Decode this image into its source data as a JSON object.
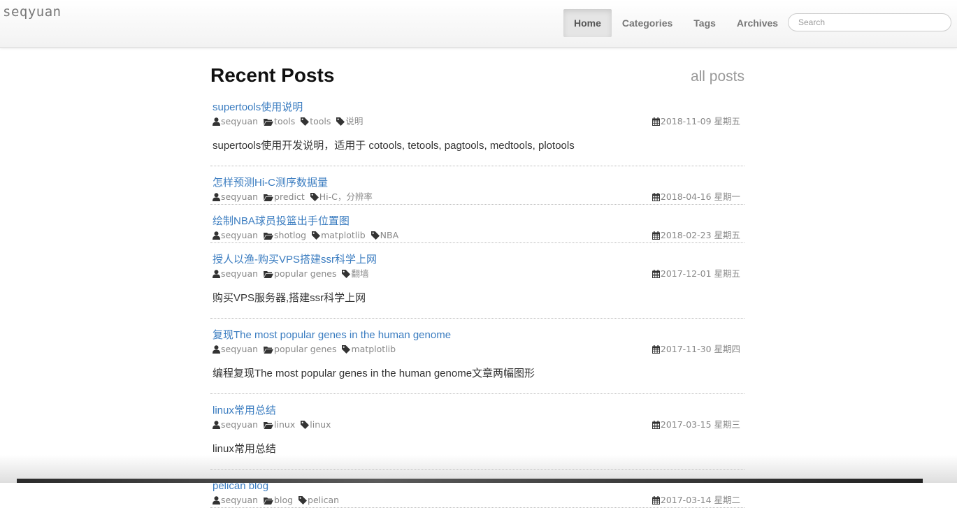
{
  "brand": "seqyuan",
  "nav": [
    {
      "label": "Home"
    },
    {
      "label": "Categories"
    },
    {
      "label": "Tags"
    },
    {
      "label": "Archives"
    }
  ],
  "search": {
    "placeholder": "Search"
  },
  "page_title": "Recent Posts",
  "all_posts_label": "all posts",
  "posts": [
    {
      "title": "supertools使用说明",
      "author": "seqyuan",
      "category": "tools",
      "tags": [
        "tools",
        "说明"
      ],
      "date": "2018-11-09 星期五",
      "summary": "supertools使用开发说明，适用于 cotools, tetools, pagtools, medtools, plotools"
    },
    {
      "title": "怎样预测Hi-C测序数据量",
      "author": "seqyuan",
      "category": "predict",
      "tags": [
        "Hi-C，分辨率"
      ],
      "date": "2018-04-16 星期一",
      "summary": ""
    },
    {
      "title": "绘制NBA球员投篮出手位置图",
      "author": "seqyuan",
      "category": "shotlog",
      "tags": [
        "matplotlib",
        "NBA"
      ],
      "date": "2018-02-23 星期五",
      "summary": ""
    },
    {
      "title": "授人以渔-购买VPS搭建ssr科学上网",
      "author": "seqyuan",
      "category": "popular genes",
      "tags": [
        "翻墙"
      ],
      "date": "2017-12-01 星期五",
      "summary": "购买VPS服务器,搭建ssr科学上网"
    },
    {
      "title": "复现The most popular genes in the human genome",
      "author": "seqyuan",
      "category": "popular genes",
      "tags": [
        "matplotlib"
      ],
      "date": "2017-11-30 星期四",
      "summary": "编程复现The most popular genes in the human genome文章两幅图形"
    },
    {
      "title": "linux常用总结",
      "author": "seqyuan",
      "category": "linux",
      "tags": [
        "linux"
      ],
      "date": "2017-03-15 星期三",
      "summary": "linux常用总结"
    },
    {
      "title": "pelican blog",
      "author": "seqyuan",
      "category": "blog",
      "tags": [
        "pelican"
      ],
      "date": "2017-03-14 星期二",
      "summary": ""
    }
  ]
}
